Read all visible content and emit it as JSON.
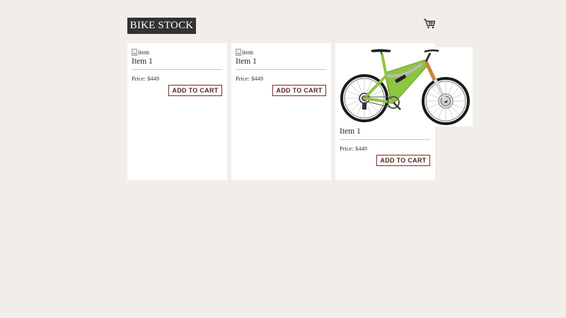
{
  "header": {
    "logo_text": "BIKE STOCK",
    "cart_icon": "shopping-cart-icon"
  },
  "products": [
    {
      "image_alt": "item",
      "image_state": "broken",
      "name": "Item 1",
      "price": "Price: $449",
      "button_label": "ADD TO CART"
    },
    {
      "image_alt": "item",
      "image_state": "broken",
      "name": "Item 1",
      "price": "Price: $449",
      "button_label": "ADD TO CART"
    },
    {
      "image_alt": "item",
      "image_state": "loaded",
      "image_subject": "green mountain bike",
      "name": "Item 1",
      "price": "Price: $449",
      "button_label": "ADD TO CART"
    }
  ],
  "colors": {
    "background": "#f1eeea",
    "logo_bg": "#333231",
    "button_border": "#7a2a24",
    "bike_frame": "#8cc63f"
  }
}
